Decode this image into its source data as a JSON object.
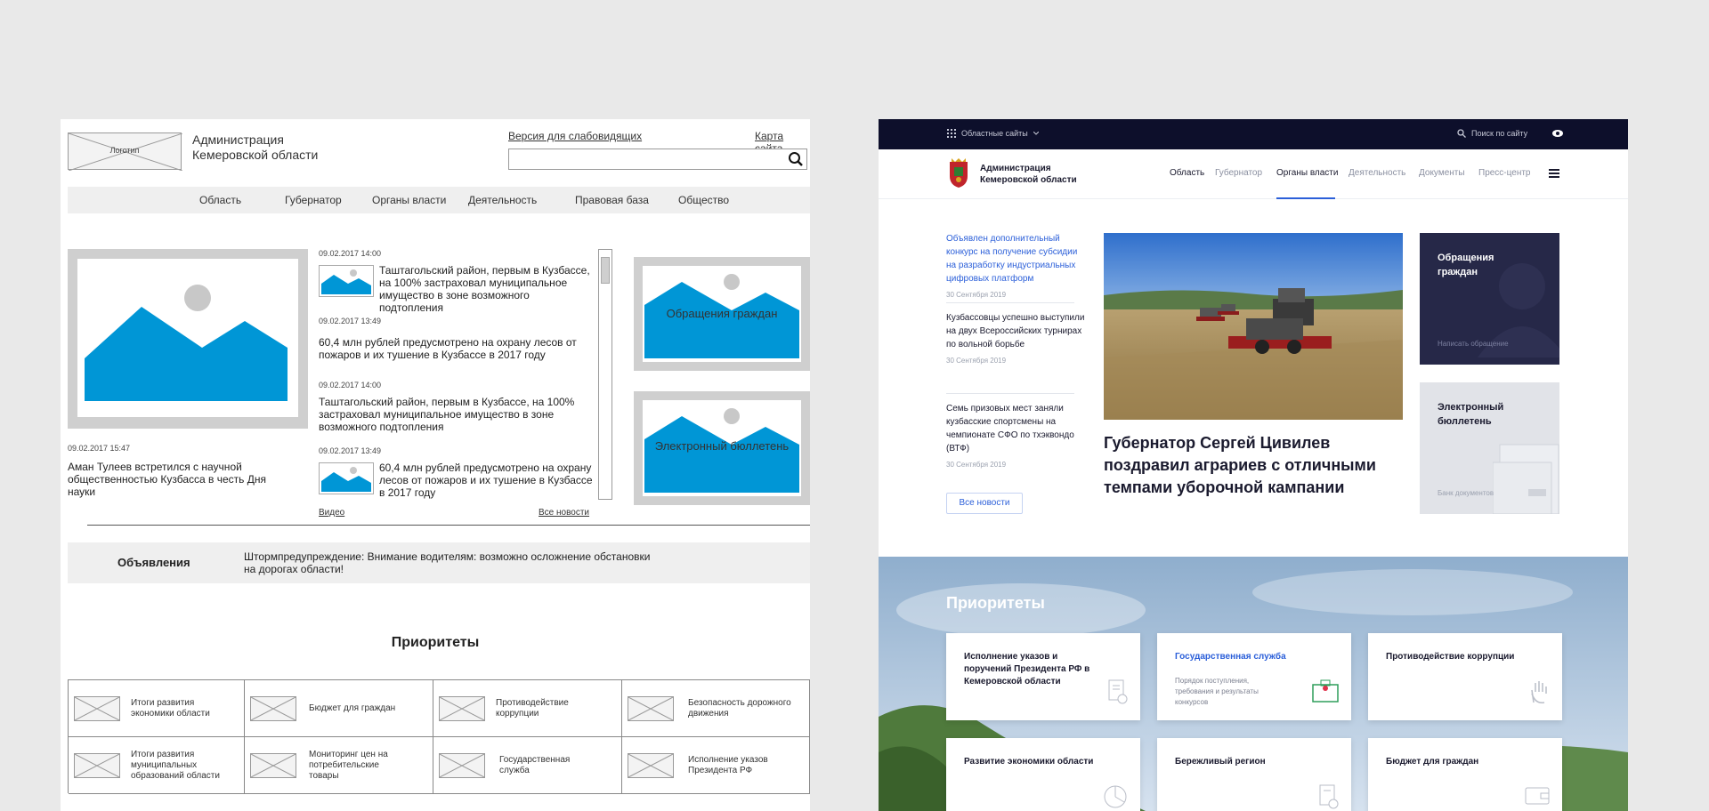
{
  "wireframe": {
    "logo_label": "Логотип",
    "org_name": "Администрация Кемеровской области",
    "link_low_vision": "Версия для слабовидящих",
    "link_sitemap": "Карта сайта",
    "nav": [
      "Область",
      "Губернатор",
      "Органы власти",
      "Деятельность",
      "Правовая база",
      "Общество"
    ],
    "main_news": {
      "date": "09.02.2017 15:47",
      "title": "Аман Тулеев встретился с научной общественностью Кузбасса в честь Дня науки"
    },
    "news": [
      {
        "date": "09.02.2017 14:00",
        "title": "Таштагольский район, первым в Кузбассе, на 100% застраховал муниципальное имущество в зоне возможного подтопления"
      },
      {
        "date": "09.02.2017 13:49",
        "title": "60,4 млн рублей предусмотрено на охрану лесов от пожаров и их тушение в Кузбассе в 2017 году"
      },
      {
        "date": "09.02.2017 14:00",
        "title": "Таштагольский район, первым в Кузбассе, на 100% застраховал муниципальное имущество в зоне возможного подтопления"
      },
      {
        "date": "09.02.2017 13:49",
        "title": "60,4 млн рублей предусмотрено на охрану лесов от пожаров и их тушение в Кузбассе в 2017 году"
      }
    ],
    "link_video": "Видео",
    "link_all_news": "Все новости",
    "card_appeals": "Обращения граждан",
    "card_bulletin": "Электронный бюллетень",
    "announcements": {
      "title": "Объявления",
      "text": "Штормпредупреждение: Внимание водителям: возможно осложнение обстановки на дорогах области!"
    },
    "priorities_title": "Приоритеты",
    "priorities": [
      "Итоги развития экономики области",
      "Бюджет для граждан",
      "Противодействие коррупции",
      "Безопасность дорожного движения",
      "Итоги развития муниципальных образований области",
      "Мониторинг цен на потребительские товары",
      "Государственная служба",
      "Исполнение указов Президента РФ"
    ]
  },
  "site": {
    "topbar": {
      "regional_sites": "Областные сайты",
      "search": "Поиск по сайту"
    },
    "org_name_line1": "Администрация",
    "org_name_line2": "Кемеровской области",
    "nav": [
      "Область",
      "Губернатор",
      "Органы власти",
      "Деятельность",
      "Документы",
      "Пресс-центр"
    ],
    "news": [
      {
        "title": "Объявлен дополнительный конкурс на получение субсидии на разработку индустриальных цифровых платформ",
        "date": "30 Сентября 2019"
      },
      {
        "title": "Кузбассовцы успешно выступили на двух Всероссийских турнирах по вольной борьбе",
        "date": "30 Сентября 2019"
      },
      {
        "title": "Семь призовых мест заняли кузбасские спортсмены на чемпионате СФО по тхэквондо (ВТФ)",
        "date": "30 Сентября 2019"
      }
    ],
    "all_news": "Все новости",
    "headline": "Губернатор Сергей Цивилев поздравил аграриев с отличными темпами уборочной кампании",
    "appeals": {
      "title": "Обращения граждан",
      "sub": "Написать обращение"
    },
    "bulletin": {
      "title": "Электронный бюллетень",
      "sub": "Банк документов"
    },
    "priorities_title": "Приоритеты",
    "priorities": [
      {
        "title": "Исполнение указов и поручений Президента РФ в Кемеровской области",
        "desc": ""
      },
      {
        "title": "Государственная служба",
        "desc": "Порядок поступления, требования и результаты конкурсов"
      },
      {
        "title": "Противодействие коррупции",
        "desc": ""
      },
      {
        "title": "Развитие экономики области",
        "desc": ""
      },
      {
        "title": "Бережливый регион",
        "desc": ""
      },
      {
        "title": "Бюджет для граждан",
        "desc": ""
      }
    ]
  },
  "colors": {
    "wire_blue": "#0096d6",
    "site_navy": "#0d0f2b",
    "site_accent": "#2b5fd9",
    "dark_card": "#262848"
  }
}
